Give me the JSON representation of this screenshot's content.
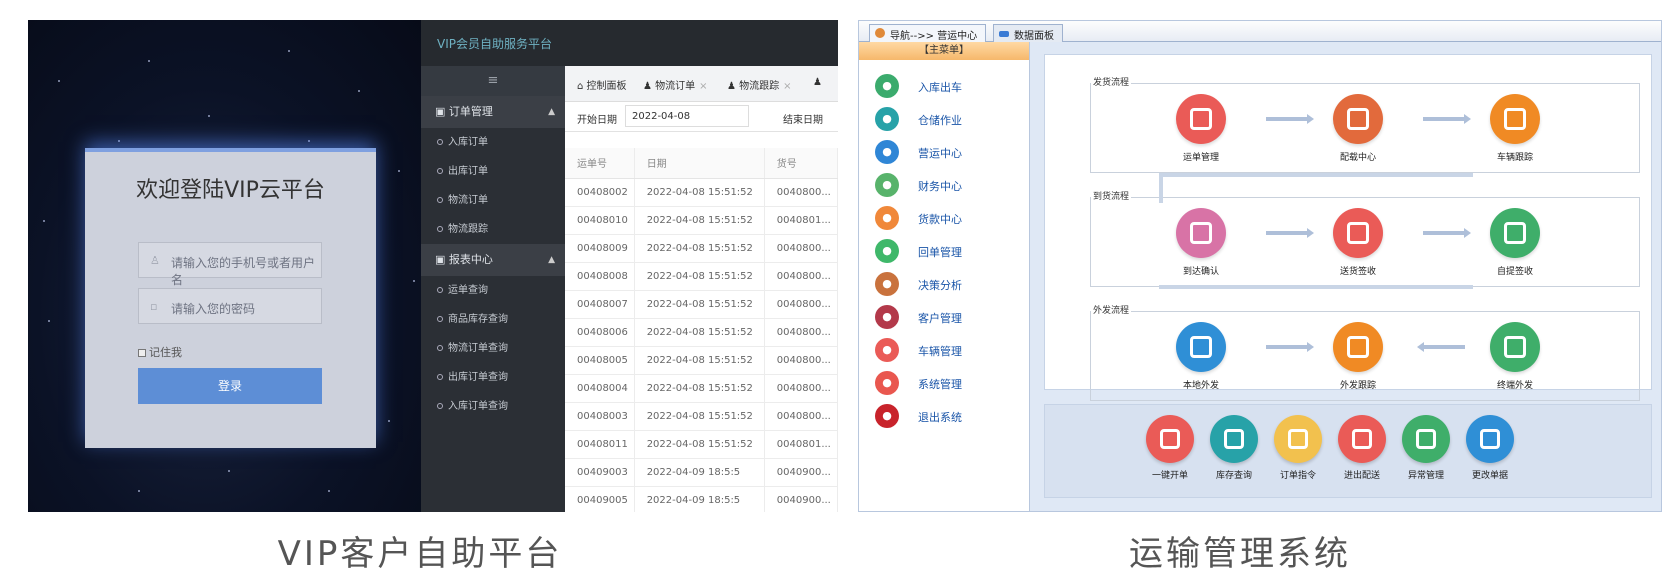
{
  "login": {
    "title": "欢迎登陆VIP云平台",
    "username_placeholder": "请输入您的手机号或者用户名",
    "password_placeholder": "请输入您的密码",
    "remember_label": "记住我",
    "submit_label": "登录",
    "caption": "VIP客户自助平台"
  },
  "vip": {
    "app_title": "VIP会员自助服务平台",
    "menu_toggle": "≡",
    "groups": [
      {
        "label": "订单管理",
        "items": [
          "入库订单",
          "出库订单",
          "物流订单",
          "物流跟踪"
        ]
      },
      {
        "label": "报表中心",
        "items": [
          "运单查询",
          "商品库存查询",
          "物流订单查询",
          "出库订单查询",
          "入库订单查询"
        ]
      }
    ],
    "tabs": [
      "控制面板",
      "物流订单",
      "物流跟踪"
    ],
    "filter": {
      "start_label": "开始日期",
      "start_value": "2022-04-08",
      "end_label": "结束日期"
    },
    "table": {
      "headers": [
        "运单号",
        "日期",
        "货号"
      ],
      "rows": [
        [
          "00408002",
          "2022-04-08 15:51:52",
          "0040800..."
        ],
        [
          "00408010",
          "2022-04-08 15:51:52",
          "0040801..."
        ],
        [
          "00408009",
          "2022-04-08 15:51:52",
          "0040800..."
        ],
        [
          "00408008",
          "2022-04-08 15:51:52",
          "0040800..."
        ],
        [
          "00408007",
          "2022-04-08 15:51:52",
          "0040800..."
        ],
        [
          "00408006",
          "2022-04-08 15:51:52",
          "0040800..."
        ],
        [
          "00408005",
          "2022-04-08 15:51:52",
          "0040800..."
        ],
        [
          "00408004",
          "2022-04-08 15:51:52",
          "0040800..."
        ],
        [
          "00408003",
          "2022-04-08 15:51:52",
          "0040800..."
        ],
        [
          "00408011",
          "2022-04-08 15:51:52",
          "0040801..."
        ],
        [
          "00409003",
          "2022-04-09 18:5:5",
          "0040900..."
        ],
        [
          "00409005",
          "2022-04-09 18:5:5",
          "0040900..."
        ]
      ]
    }
  },
  "tms": {
    "tabs": [
      "导航-->> 营运中心",
      "数据面板"
    ],
    "menu_header": "【主菜单】",
    "menu": [
      {
        "label": "入库出车",
        "color": "#3bab6d"
      },
      {
        "label": "仓储作业",
        "color": "#27a2a8"
      },
      {
        "label": "营运中心",
        "color": "#2f86d6"
      },
      {
        "label": "财务中心",
        "color": "#58b36b"
      },
      {
        "label": "货款中心",
        "color": "#f0883a"
      },
      {
        "label": "回单管理",
        "color": "#3fb86a"
      },
      {
        "label": "决策分析",
        "color": "#c9723d"
      },
      {
        "label": "客户管理",
        "color": "#b3394a"
      },
      {
        "label": "车辆管理",
        "color": "#ea5b57"
      },
      {
        "label": "系统管理",
        "color": "#e9574f"
      },
      {
        "label": "退出系统",
        "color": "#c8232b"
      }
    ],
    "sections": [
      {
        "label": "发货流程",
        "nodes": [
          {
            "label": "运单管理",
            "color": "#ea5b57",
            "icon": "copy-icon"
          },
          {
            "label": "配载中心",
            "color": "#e26a3c",
            "icon": "bus-icon"
          },
          {
            "label": "车辆跟踪",
            "color": "#f08a24",
            "icon": "signal-icon"
          }
        ]
      },
      {
        "label": "到货流程",
        "nodes": [
          {
            "label": "到达确认",
            "color": "#d873a6",
            "icon": "keypad-icon"
          },
          {
            "label": "送货签收",
            "color": "#ea5b57",
            "icon": "truck-icon"
          },
          {
            "label": "自提签收",
            "color": "#3fae6a",
            "icon": "form-icon"
          }
        ]
      },
      {
        "label": "外发流程",
        "nodes": [
          {
            "label": "本地外发",
            "color": "#2f8fd6",
            "icon": "home-icon"
          },
          {
            "label": "外发跟踪",
            "color": "#f08a24",
            "icon": "phone-icon"
          },
          {
            "label": "终端外发",
            "color": "#3fae6a",
            "icon": "home-icon"
          }
        ]
      }
    ],
    "quick": [
      {
        "label": "一键开单",
        "color": "#ea5b57",
        "icon": "edit-icon"
      },
      {
        "label": "库存查询",
        "color": "#27a2a8",
        "icon": "search-icon"
      },
      {
        "label": "订单指令",
        "color": "#f2c14e",
        "icon": "document-icon"
      },
      {
        "label": "进出配送",
        "color": "#ea5b57",
        "icon": "truck-icon"
      },
      {
        "label": "异常管理",
        "color": "#3fae6a",
        "icon": "box-icon"
      },
      {
        "label": "更改单据",
        "color": "#2f8fd6",
        "icon": "link-icon"
      }
    ],
    "caption": "运输管理系统"
  }
}
